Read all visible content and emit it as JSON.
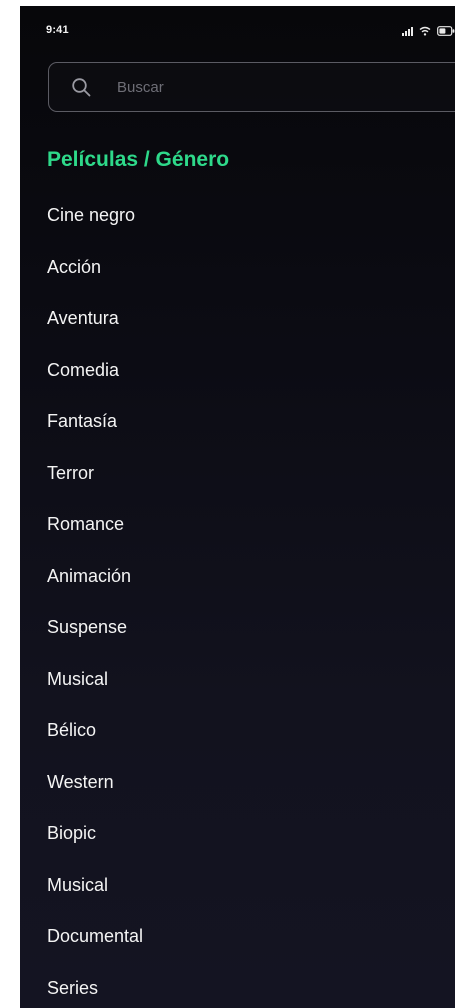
{
  "status_bar": {
    "time": "9:41",
    "icons": [
      "signal-icon",
      "wifi-icon",
      "battery-icon"
    ]
  },
  "search": {
    "placeholder": "Buscar",
    "value": "",
    "icon": "search-icon"
  },
  "section_title": "Películas / Género",
  "genres": [
    "Cine negro",
    "Acción",
    "Aventura",
    "Comedia",
    "Fantasía",
    "Terror",
    "Romance",
    "Animación",
    "Suspense",
    "Musical",
    "Bélico",
    "Western",
    "Biopic",
    "Musical",
    "Documental",
    "Series"
  ],
  "colors": {
    "accent": "#2ed98a",
    "background_top": "#07070a",
    "background_bottom": "#141422",
    "text": "#f4f4f4",
    "search_border": "#5b5b63"
  }
}
